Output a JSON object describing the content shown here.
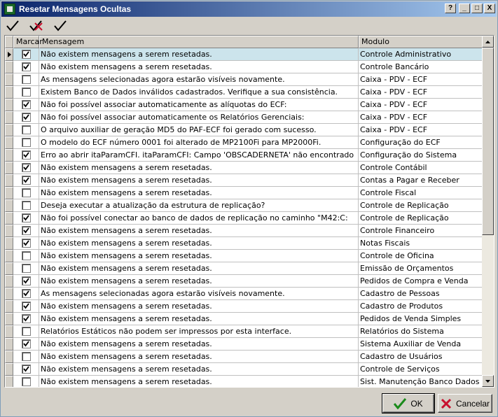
{
  "window": {
    "title": "Resetar Mensagens Ocultas",
    "help_label": "?",
    "minimize_label": "_",
    "maximize_label": "□",
    "close_label": "X"
  },
  "toolbar": {
    "icons": [
      "check-icon",
      "uncheck-icon",
      "check-icon"
    ]
  },
  "grid": {
    "columns": [
      "Marcar",
      "Mensagem",
      "Modulo"
    ],
    "rows": [
      {
        "checked": true,
        "message": "Não existem mensagens a serem resetadas.",
        "module": "Controle Administrativo",
        "selected": true
      },
      {
        "checked": true,
        "message": "Não existem mensagens a serem resetadas.",
        "module": "Controle Bancário"
      },
      {
        "checked": false,
        "message": "As mensagens selecionadas agora estarão visíveis novamente.",
        "module": "Caixa - PDV - ECF"
      },
      {
        "checked": false,
        "message": "Existem Banco de Dados inválidos cadastrados. Verifique a sua consistência.",
        "module": "Caixa - PDV - ECF"
      },
      {
        "checked": true,
        "message": "Não foi possível associar automaticamente as alíquotas do ECF:",
        "module": "Caixa - PDV - ECF"
      },
      {
        "checked": true,
        "message": "Não foi possível associar automaticamente os Relatórios Gerenciais:",
        "module": "Caixa - PDV - ECF"
      },
      {
        "checked": false,
        "message": "O arquivo auxiliar de geração MD5 do PAF-ECF foi gerado com sucesso.",
        "module": "Caixa - PDV - ECF"
      },
      {
        "checked": false,
        "message": "O modelo do ECF número 0001 foi alterado de MP2100Fi para MP2000Fi.",
        "module": "Configuração do ECF"
      },
      {
        "checked": true,
        "message": "Erro ao abrir itaParamCFI. itaParamCFI: Campo 'OBSCADERNETA' não encontrado",
        "module": "Configuração do Sistema"
      },
      {
        "checked": true,
        "message": "Não existem mensagens a serem resetadas.",
        "module": "Controle Contábil"
      },
      {
        "checked": true,
        "message": "Não existem mensagens a serem resetadas.",
        "module": "Contas a Pagar e Receber"
      },
      {
        "checked": false,
        "message": "Não existem mensagens a serem resetadas.",
        "module": "Controle Fiscal"
      },
      {
        "checked": false,
        "message": "Deseja executar a atualização da estrutura de replicação?",
        "module": "Controle de Replicação"
      },
      {
        "checked": true,
        "message": "Não foi possível conectar ao banco de dados de replicação no caminho \"M42:C:",
        "module": "Controle de Replicação"
      },
      {
        "checked": true,
        "message": "Não existem mensagens a serem resetadas.",
        "module": "Controle Financeiro"
      },
      {
        "checked": true,
        "message": "Não existem mensagens a serem resetadas.",
        "module": "Notas Fiscais"
      },
      {
        "checked": false,
        "message": "Não existem mensagens a serem resetadas.",
        "module": "Controle de Oficina"
      },
      {
        "checked": false,
        "message": "Não existem mensagens a serem resetadas.",
        "module": "Emissão de Orçamentos"
      },
      {
        "checked": true,
        "message": "Não existem mensagens a serem resetadas.",
        "module": "Pedidos de Compra e Venda"
      },
      {
        "checked": true,
        "message": "As mensagens selecionadas agora estarão visíveis novamente.",
        "module": "Cadastro de Pessoas"
      },
      {
        "checked": true,
        "message": "Não existem mensagens a serem resetadas.",
        "module": "Cadastro de Produtos"
      },
      {
        "checked": true,
        "message": "Não existem mensagens a serem resetadas.",
        "module": "Pedidos de Venda Simples"
      },
      {
        "checked": false,
        "message": "Relatórios Estáticos não podem ser impressos por esta interface.",
        "module": "Relatórios do Sistema"
      },
      {
        "checked": true,
        "message": "Não existem mensagens a serem resetadas.",
        "module": "Sistema Auxiliar de Venda"
      },
      {
        "checked": false,
        "message": "Não existem mensagens a serem resetadas.",
        "module": "Cadastro de Usuários"
      },
      {
        "checked": true,
        "message": "Não existem mensagens a serem resetadas.",
        "module": "Controle de Serviços"
      },
      {
        "checked": false,
        "message": "Não existem mensagens a serem resetadas.",
        "module": "Sist. Manutenção Banco Dados"
      }
    ]
  },
  "buttons": {
    "ok_label": "OK",
    "cancel_label": "Cancelar"
  },
  "colors": {
    "check_green": "#1a8a1a",
    "cancel_red": "#c8102e",
    "selected_row": "#cce4ec"
  }
}
